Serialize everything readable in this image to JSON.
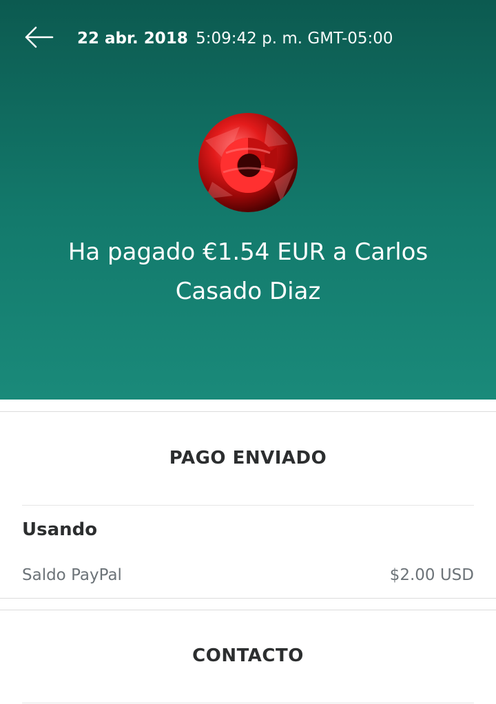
{
  "header": {
    "date": "22 abr. 2018",
    "time": "5:09:42 p. m. GMT-05:00",
    "title_line1": "Ha pagado €1.54 EUR a Carlos",
    "title_line2": "Casado Diaz",
    "back_icon": "arrow-left-icon",
    "avatar_icon": "red-c-logo-avatar"
  },
  "payment": {
    "status_heading": "PAGO ENVIADO",
    "using_label": "Usando",
    "source_name": "Saldo PayPal",
    "source_amount": "$2.00 USD"
  },
  "contact": {
    "heading": "CONTACTO"
  },
  "colors": {
    "header_dark": "#0c5a50",
    "header_light": "#1a8a7a",
    "text_dark": "#2c2e2f",
    "text_muted": "#6c7378"
  }
}
